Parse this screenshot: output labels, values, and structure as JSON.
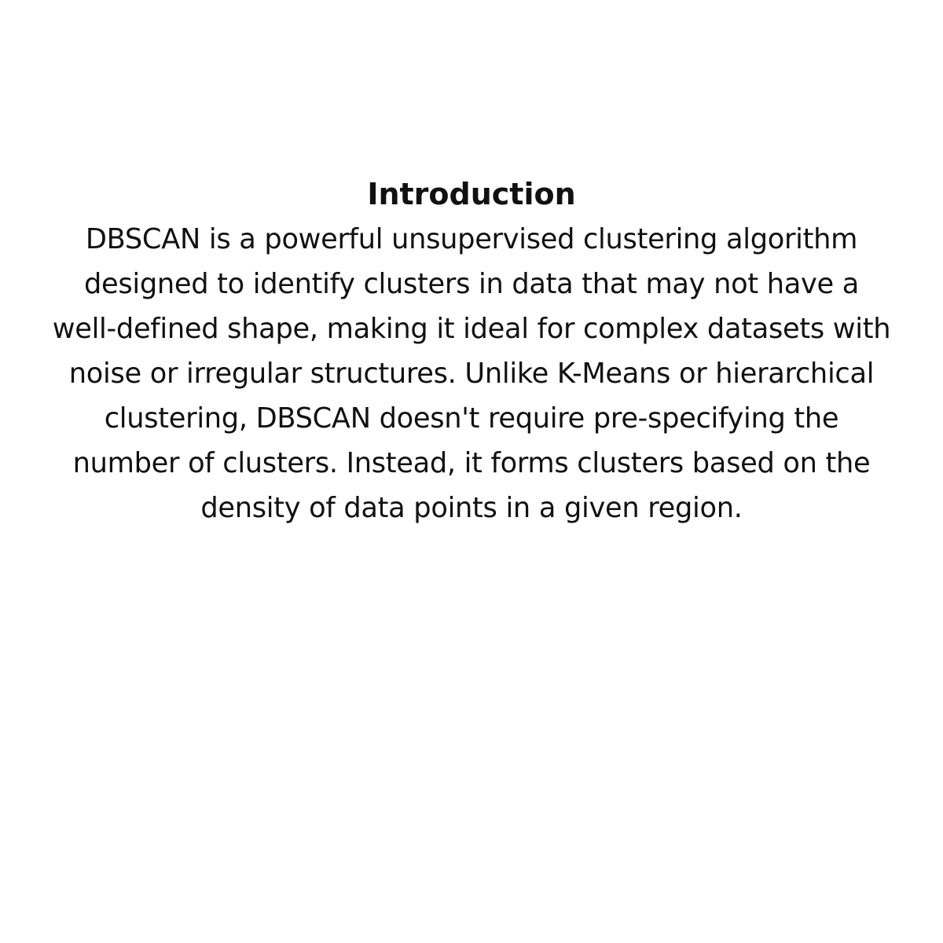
{
  "heading": "Introduction",
  "body_lines": [
    "DBSCAN is a powerful unsupervised clustering algorithm",
    "designed to identify clusters in data that may not have a",
    "well-defined shape, making it ideal for complex datasets with",
    "noise or irregular structures. Unlike K-Means or hierarchical",
    "clustering, DBSCAN doesn't require pre-specifying the",
    "number of clusters. Instead, it forms clusters based on the",
    "density of data points in a given region."
  ],
  "colors": {
    "background": "#ffffff",
    "text": "#111111"
  }
}
